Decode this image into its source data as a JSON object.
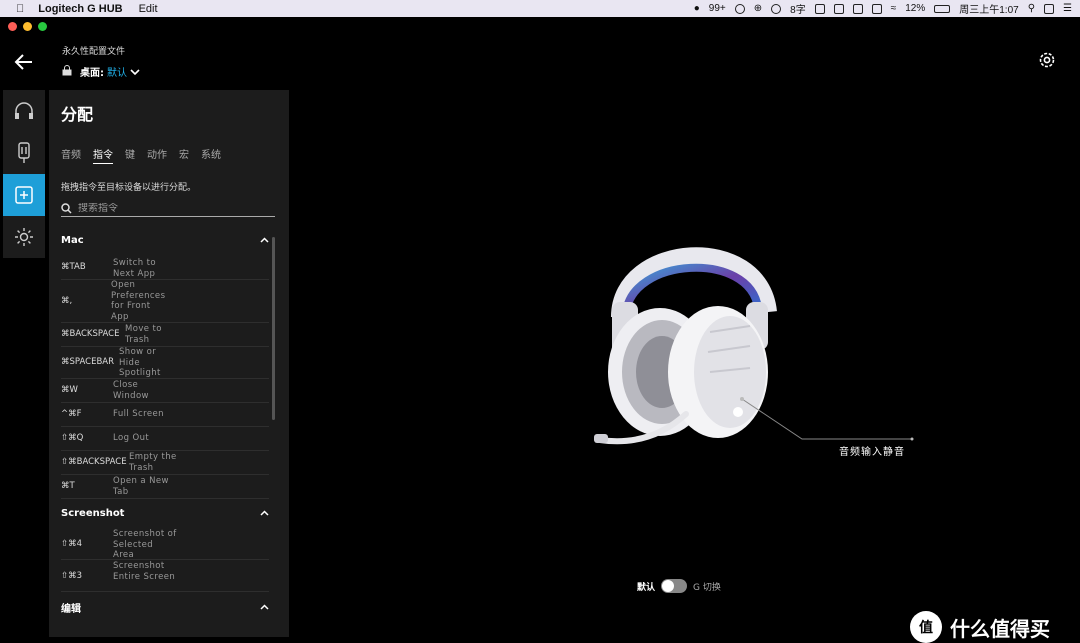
{
  "menubar": {
    "app_name": "Logitech G HUB",
    "edit": "Edit",
    "notifications": "99+",
    "storage": "8字",
    "battery": "12%",
    "clock": "周三上午1:07"
  },
  "header": {
    "profile_caption": "永久性配置文件",
    "profile_key": "桌面:",
    "profile_value": "默认"
  },
  "panel": {
    "title": "分配",
    "tabs": [
      "音频",
      "指令",
      "键",
      "动作",
      "宏",
      "系统"
    ],
    "active_tab": "指令",
    "instruction": "拖拽指令至目标设备以进行分配。",
    "search_placeholder": "搜索指令",
    "sections": [
      {
        "title": "Mac",
        "rows": [
          {
            "key": "⌘TAB",
            "desc": "Switch to Next App"
          },
          {
            "key": "⌘,",
            "desc": "Open Preferences for Front App"
          },
          {
            "key": "⌘BACKSPACE",
            "desc": "Move to Trash"
          },
          {
            "key": "⌘SPACEBAR",
            "desc": "Show or Hide Spotlight"
          },
          {
            "key": "⌘W",
            "desc": "Close Window"
          },
          {
            "key": "^⌘F",
            "desc": "Full Screen"
          },
          {
            "key": "⇧⌘Q",
            "desc": "Log Out"
          },
          {
            "key": "⇧⌘BACKSPACE",
            "desc": "Empty the Trash"
          },
          {
            "key": "⌘T",
            "desc": "Open a New Tab"
          }
        ]
      },
      {
        "title": "Screenshot",
        "rows": [
          {
            "key": "⇧⌘4",
            "desc": "Screenshot of Selected Area"
          },
          {
            "key": "⇧⌘3",
            "desc": "Screenshot Entire Screen"
          }
        ]
      },
      {
        "title": "编辑",
        "rows": []
      }
    ]
  },
  "device": {
    "callout_label": "音频输入静音"
  },
  "footer": {
    "toggle_left": "默认",
    "toggle_right": "G 切换"
  },
  "watermark": {
    "logo": "值",
    "text": "什么值得买"
  },
  "colors": {
    "accent": "#1e9fd8",
    "profile_value": "#21b0e8",
    "panel_bg": "#1c1c1c"
  }
}
